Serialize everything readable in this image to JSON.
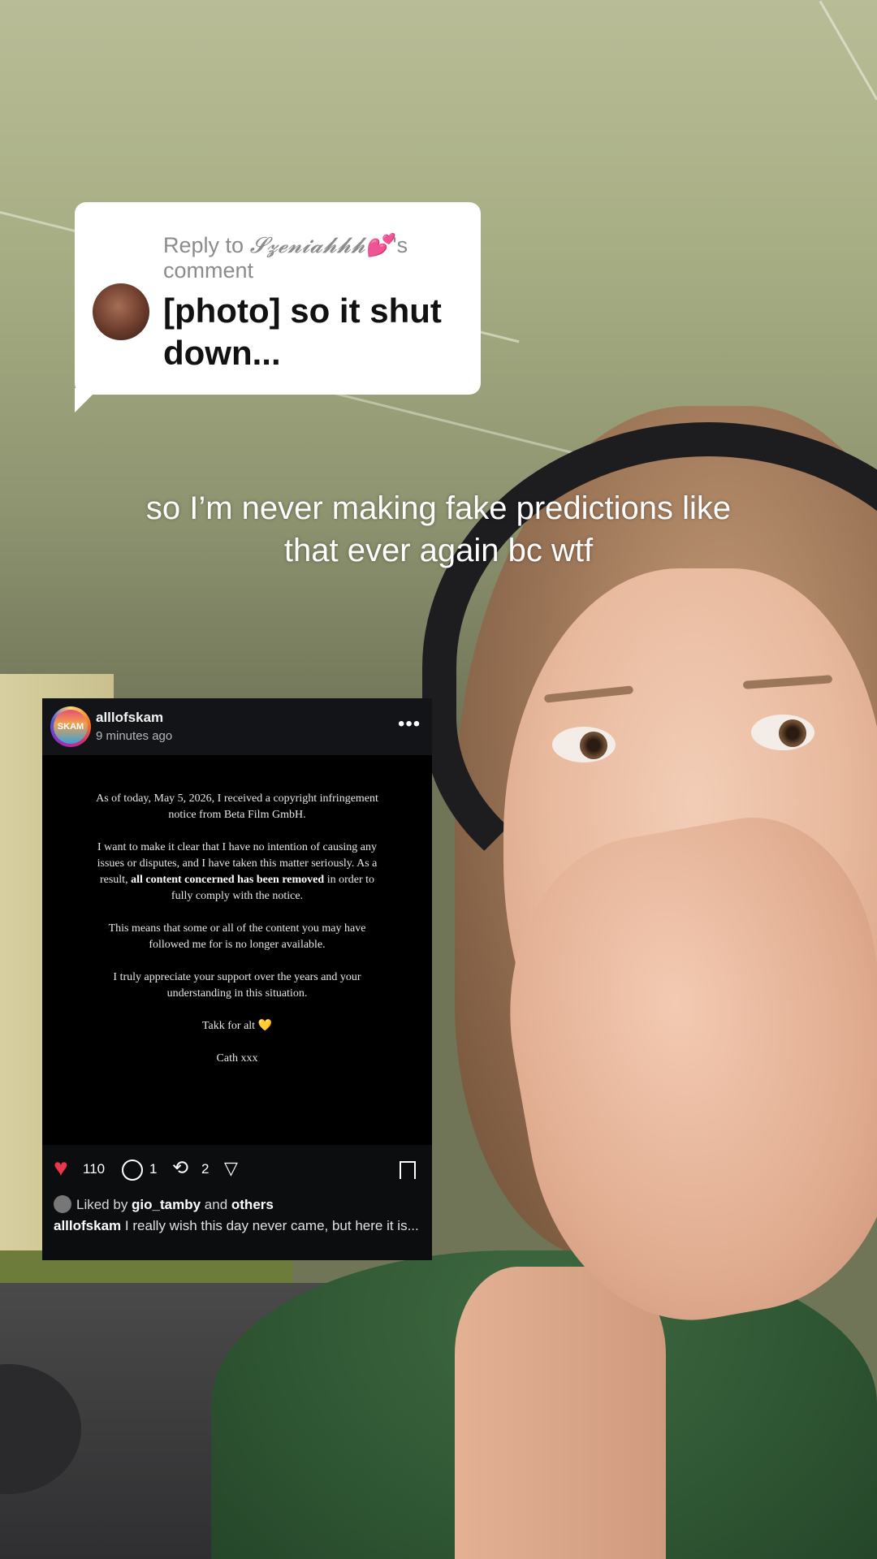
{
  "reply": {
    "label_prefix": "Reply to ",
    "commenter": "𝓢𝔃𝓮𝓷𝓲𝓪𝓱𝓱𝓱💕",
    "label_suffix": "'s comment",
    "text": "[photo] so it shut down..."
  },
  "caption": {
    "line1": "so I’m never making fake predictions like",
    "line2": "that ever again bc wtf"
  },
  "post": {
    "username": "alllofskam",
    "time": "9 minutes ago",
    "avatar_text": "SKAM",
    "more": "•••",
    "notice": {
      "p1": "As of today, May 5, 2026, I received a copyright infringement notice from Beta Film GmbH.",
      "p2_a": "I want to make it clear that I have no intention of causing any issues or disputes, and I have taken this matter seriously. As a result, ",
      "p2_bold": "all content concerned has been removed",
      "p2_b": " in order to fully comply with the notice.",
      "p3": "This means that some or all of the content you may have followed me for is no longer available.",
      "p4": "I truly appreciate your support over the years and your understanding in this situation.",
      "p5": "Takk for alt 💛",
      "p6": "Cath xxx"
    },
    "likes": "110",
    "comments": "1",
    "reposts": "2",
    "liked_by_prefix": "Liked by ",
    "liked_by_user": "gio_tamby",
    "liked_by_and": " and ",
    "liked_by_others": "others",
    "caption_user": "alllofskam",
    "caption_text": " I really wish this day never came, but here it is..."
  },
  "icons": [
    "heart-icon",
    "comment-icon",
    "repost-icon",
    "share-icon",
    "bookmark-icon",
    "more-icon"
  ],
  "colors": {
    "heart": "#e8364a",
    "card_bg": "#0b0d0f"
  }
}
